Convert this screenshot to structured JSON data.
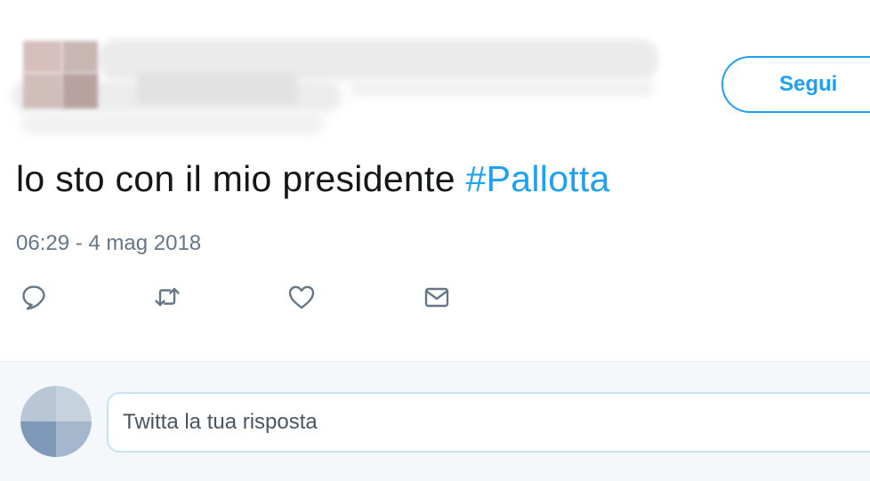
{
  "header": {
    "follow_label": "Segui"
  },
  "tweet": {
    "text": "lo sto con il mio presidente",
    "hashtag": "#Pallotta",
    "timestamp": "06:29 - 4 mag 2018"
  },
  "actions": {
    "reply_icon": "reply-icon",
    "retweet_icon": "retweet-icon",
    "like_icon": "heart-icon",
    "dm_icon": "envelope-icon"
  },
  "reply_box": {
    "placeholder": "Twitta la tua risposta",
    "value": ""
  },
  "colors": {
    "accent": "#1da1f2",
    "text": "#14171a",
    "muted": "#657786",
    "reply_bg": "#f5f8fa"
  }
}
